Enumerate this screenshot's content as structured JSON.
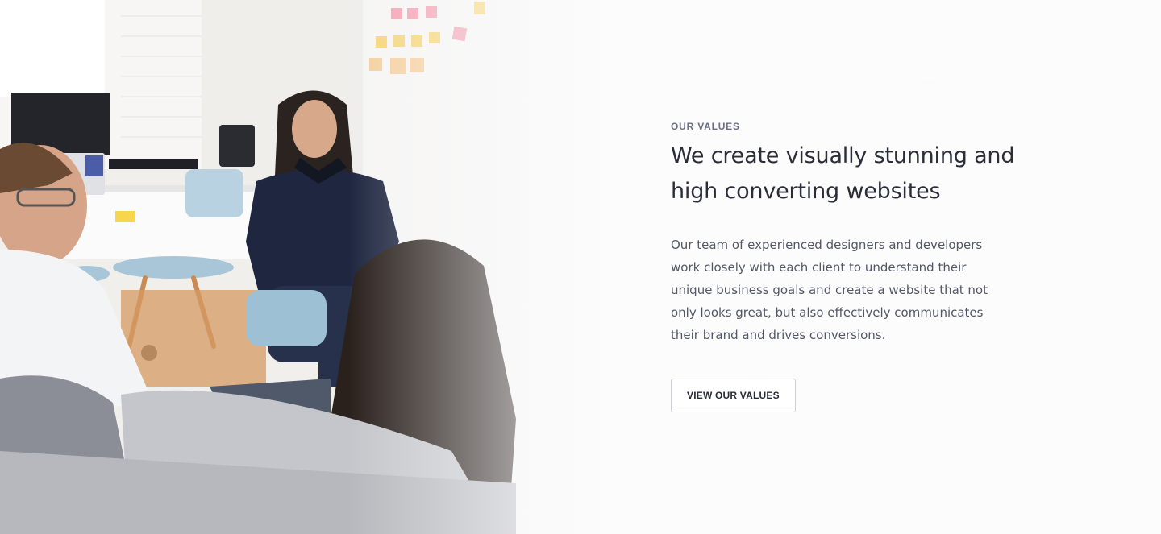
{
  "section": {
    "eyebrow": "OUR VALUES",
    "headline": "We create visually stunning and high converting websites",
    "body": "Our team of experienced designers and developers work closely with each client to understand their unique business goals and create a website that not only looks great, but also effectively communicates their brand and drives conversions.",
    "cta_label": "VIEW OUR VALUES"
  },
  "colors": {
    "eyebrow": "#6b6d85",
    "headline": "#2c2d38",
    "body": "#555767",
    "button_border": "#cfd0d6"
  }
}
